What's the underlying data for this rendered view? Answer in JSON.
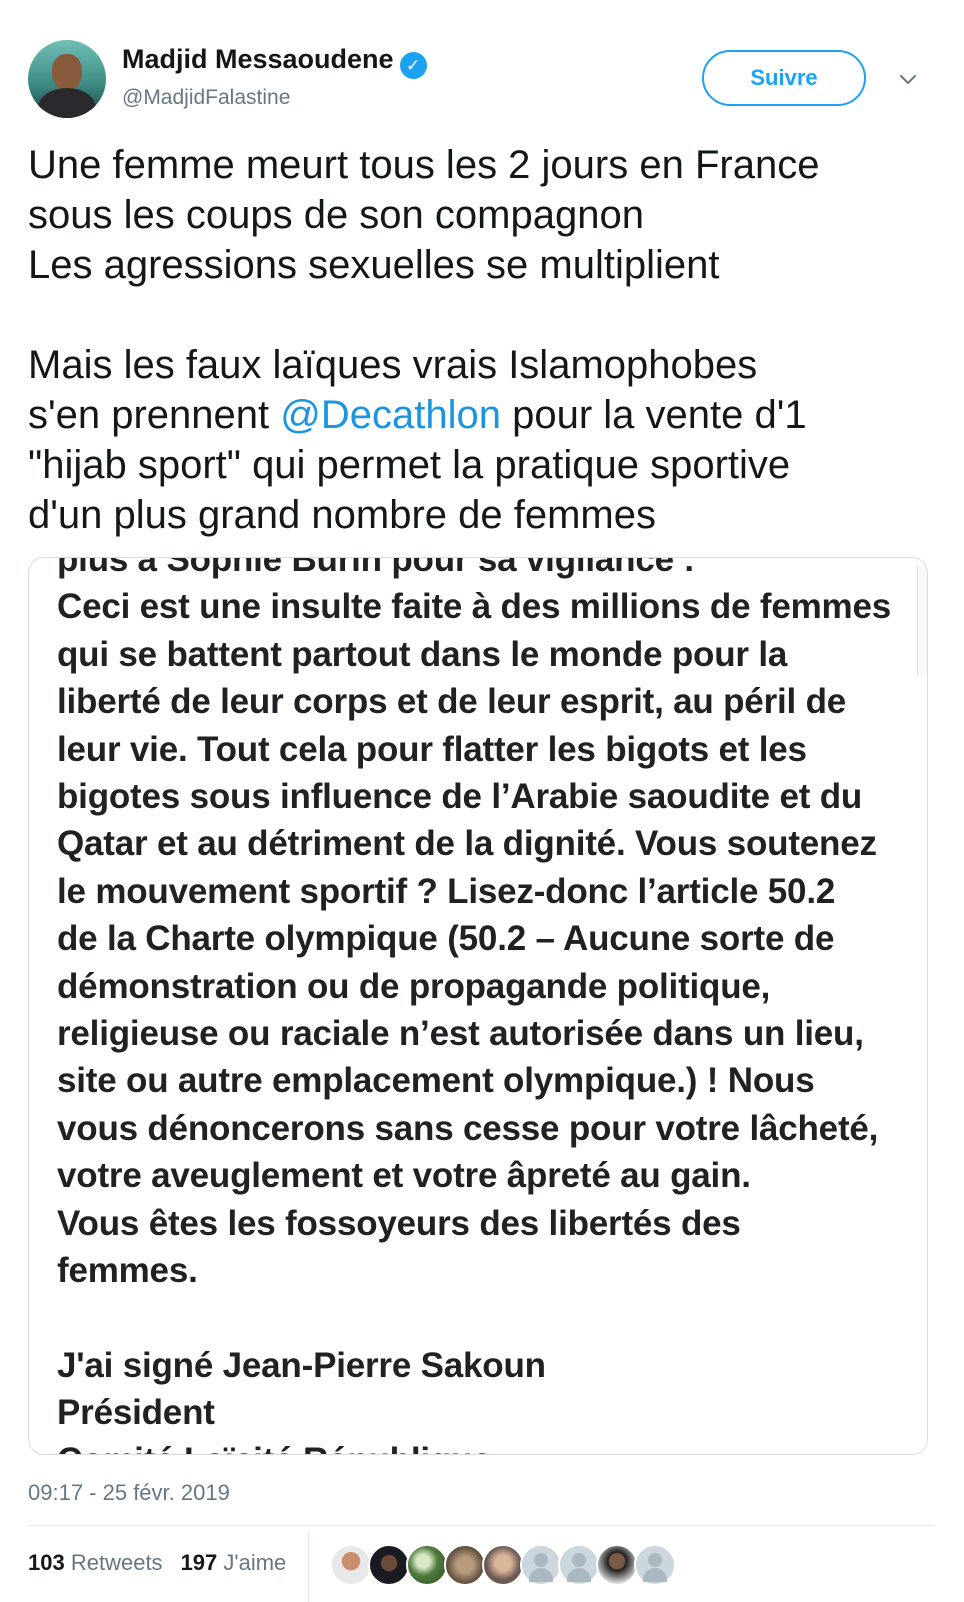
{
  "author": {
    "name": "Madjid Messaoudene",
    "handle": "@MadjidFalastine",
    "verified_icon": "verified-badge-icon",
    "avatar_icon": "profile-photo"
  },
  "follow_button": {
    "label": "Suivre"
  },
  "menu_icon": "chevron-down-icon",
  "tweet": {
    "lines_1": [
      "Une femme meurt tous les 2 jours en France",
      "sous les coups de son compagnon",
      "Les agressions sexuelles se multiplient"
    ],
    "line_4": "Mais les faux laïques vrais Islamophobes",
    "line_5_before": "s'en prennent ",
    "mention": "@Decathlon",
    "line_5_after": " pour la vente d'1",
    "line_6": "\"hijab sport\" qui permet la pratique sportive",
    "line_7": "d'un plus grand nombre de femmes"
  },
  "media": {
    "lines": [
      "plus à Sophie Burin pour sa vigilance :",
      "Ceci est une insulte faite à des millions de femmes",
      "qui se battent partout dans le monde pour la",
      "liberté de leur corps et de leur esprit, au péril de",
      "leur vie. Tout cela pour flatter les bigots et les",
      "bigotes sous influence de l’Arabie saoudite et du",
      "Qatar et au détriment de la dignité. Vous soutenez",
      "le mouvement sportif ? Lisez-donc l’article 50.2",
      "de la Charte olympique (50.2 – Aucune sorte de",
      "démonstration ou de propagande politique,",
      "religieuse ou raciale n’est autorisée dans un lieu,",
      "site ou autre emplacement olympique.) ! Nous",
      "vous dénoncerons sans cesse pour votre lâcheté,",
      "votre aveuglement et votre âpreté au gain.",
      "Vous êtes les fossoyeurs des libertés des",
      "femmes."
    ],
    "signature_lines": [
      "J'ai signé Jean-Pierre Sakoun",
      "Président",
      "Comité Laïcité République"
    ]
  },
  "timestamp": "09:17 - 25 févr. 2019",
  "stats": {
    "retweets_count": "103",
    "retweets_label": "Retweets",
    "likes_count": "197",
    "likes_label": "J'aime"
  },
  "likers": [
    "liker-avatar-1",
    "liker-avatar-2",
    "liker-avatar-3",
    "liker-avatar-4",
    "liker-avatar-5",
    "liker-avatar-6",
    "liker-avatar-7",
    "liker-avatar-8",
    "liker-avatar-9"
  ],
  "colors": {
    "accent": "#1da1f2",
    "mention": "#1b95e0",
    "muted": "#657786",
    "text": "#14171a"
  }
}
